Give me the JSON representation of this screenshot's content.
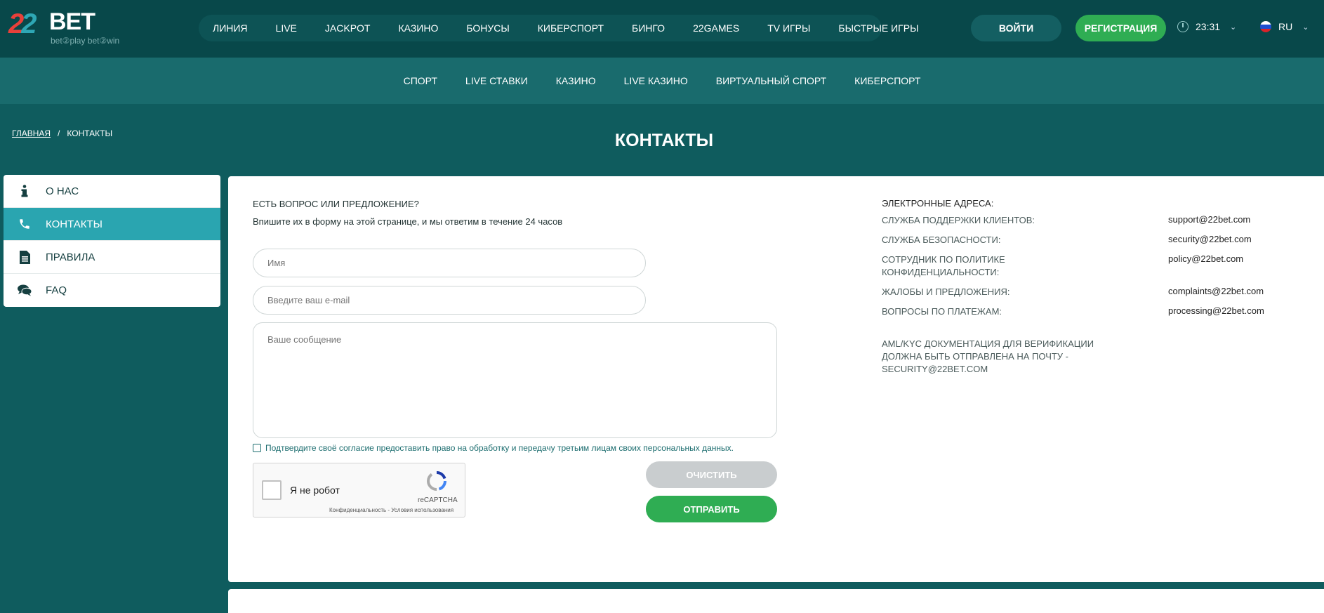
{
  "header": {
    "logo": {
      "num_a": "2",
      "num_b": "2",
      "brand": "BET",
      "tagline": "bet②play bet②win"
    },
    "nav": [
      "ЛИНИЯ",
      "LIVE",
      "JACKPOT",
      "КАЗИНО",
      "БОНУСЫ",
      "КИБЕРСПОРТ",
      "БИНГО",
      "22GAMES",
      "TV ИГРЫ",
      "БЫСТРЫЕ ИГРЫ"
    ],
    "login_label": "ВОЙТИ",
    "register_label": "РЕГИСТРАЦИЯ",
    "time": "23:31",
    "language": "RU"
  },
  "subnav": [
    "СПОРТ",
    "LIVE СТАВКИ",
    "КАЗИНО",
    "LIVE КАЗИНО",
    "ВИРТУАЛЬНЫЙ СПОРТ",
    "КИБЕРСПОРТ"
  ],
  "breadcrumb": {
    "home": "ГЛАВНАЯ",
    "separator": "/",
    "current": "КОНТАКТЫ"
  },
  "page_title": "КОНТАКТЫ",
  "sidebar": {
    "items": [
      {
        "label": "О НАС",
        "icon": "info-icon"
      },
      {
        "label": "КОНТАКТЫ",
        "icon": "phone-icon"
      },
      {
        "label": "ПРАВИЛА",
        "icon": "document-icon"
      },
      {
        "label": "FAQ",
        "icon": "chat-icon"
      }
    ],
    "active_index": 1
  },
  "form": {
    "question": "ЕСТЬ ВОПРОС ИЛИ ПРЕДЛОЖЕНИЕ?",
    "subtitle": "Впишите их в форму на этой странице, и мы ответим в течение 24 часов",
    "name_placeholder": "Имя",
    "email_placeholder": "Введите ваш e-mail",
    "message_placeholder": "Ваше сообщение",
    "consent": "Подтвердите своё согласие предоставить право на обработку и передачу третьим лицам своих персональных данных.",
    "clear_label": "ОЧИСТИТЬ",
    "send_label": "ОТПРАВИТЬ"
  },
  "captcha": {
    "label": "Я не робот",
    "brand": "reCAPTCHA",
    "links": "Конфиденциальность - Условия использования"
  },
  "contacts": {
    "heading": "ЭЛЕКТРОННЫЕ АДРЕСА:",
    "rows": [
      {
        "label": "СЛУЖБА ПОДДЕРЖКИ КЛИЕНТОВ:",
        "email": "support@22bet.com"
      },
      {
        "label": "СЛУЖБА БЕЗОПАСНОСТИ:",
        "email": "security@22bet.com"
      },
      {
        "label": "СОТРУДНИК ПО ПОЛИТИКЕ КОНФИДЕНЦИАЛЬНОСТИ:",
        "email": "policy@22bet.com"
      },
      {
        "label": "ЖАЛОБЫ И ПРЕДЛОЖЕНИЯ:",
        "email": "complaints@22bet.com"
      },
      {
        "label": "ВОПРОСЫ ПО ПЛАТЕЖАМ:",
        "email": "processing@22bet.com"
      }
    ],
    "aml_note": "AML/KYC ДОКУМЕНТАЦИЯ ДЛЯ ВЕРИФИКАЦИИ ДОЛЖНА БЫТЬ ОТПРАВЛЕНА НА ПОЧТУ - SECURITY@22BET.COM"
  },
  "colors": {
    "background": "#0f5c5e",
    "header": "#08484a",
    "subnav": "#196b6d",
    "accent_active": "#2aa5b0",
    "green": "#2fad53"
  }
}
